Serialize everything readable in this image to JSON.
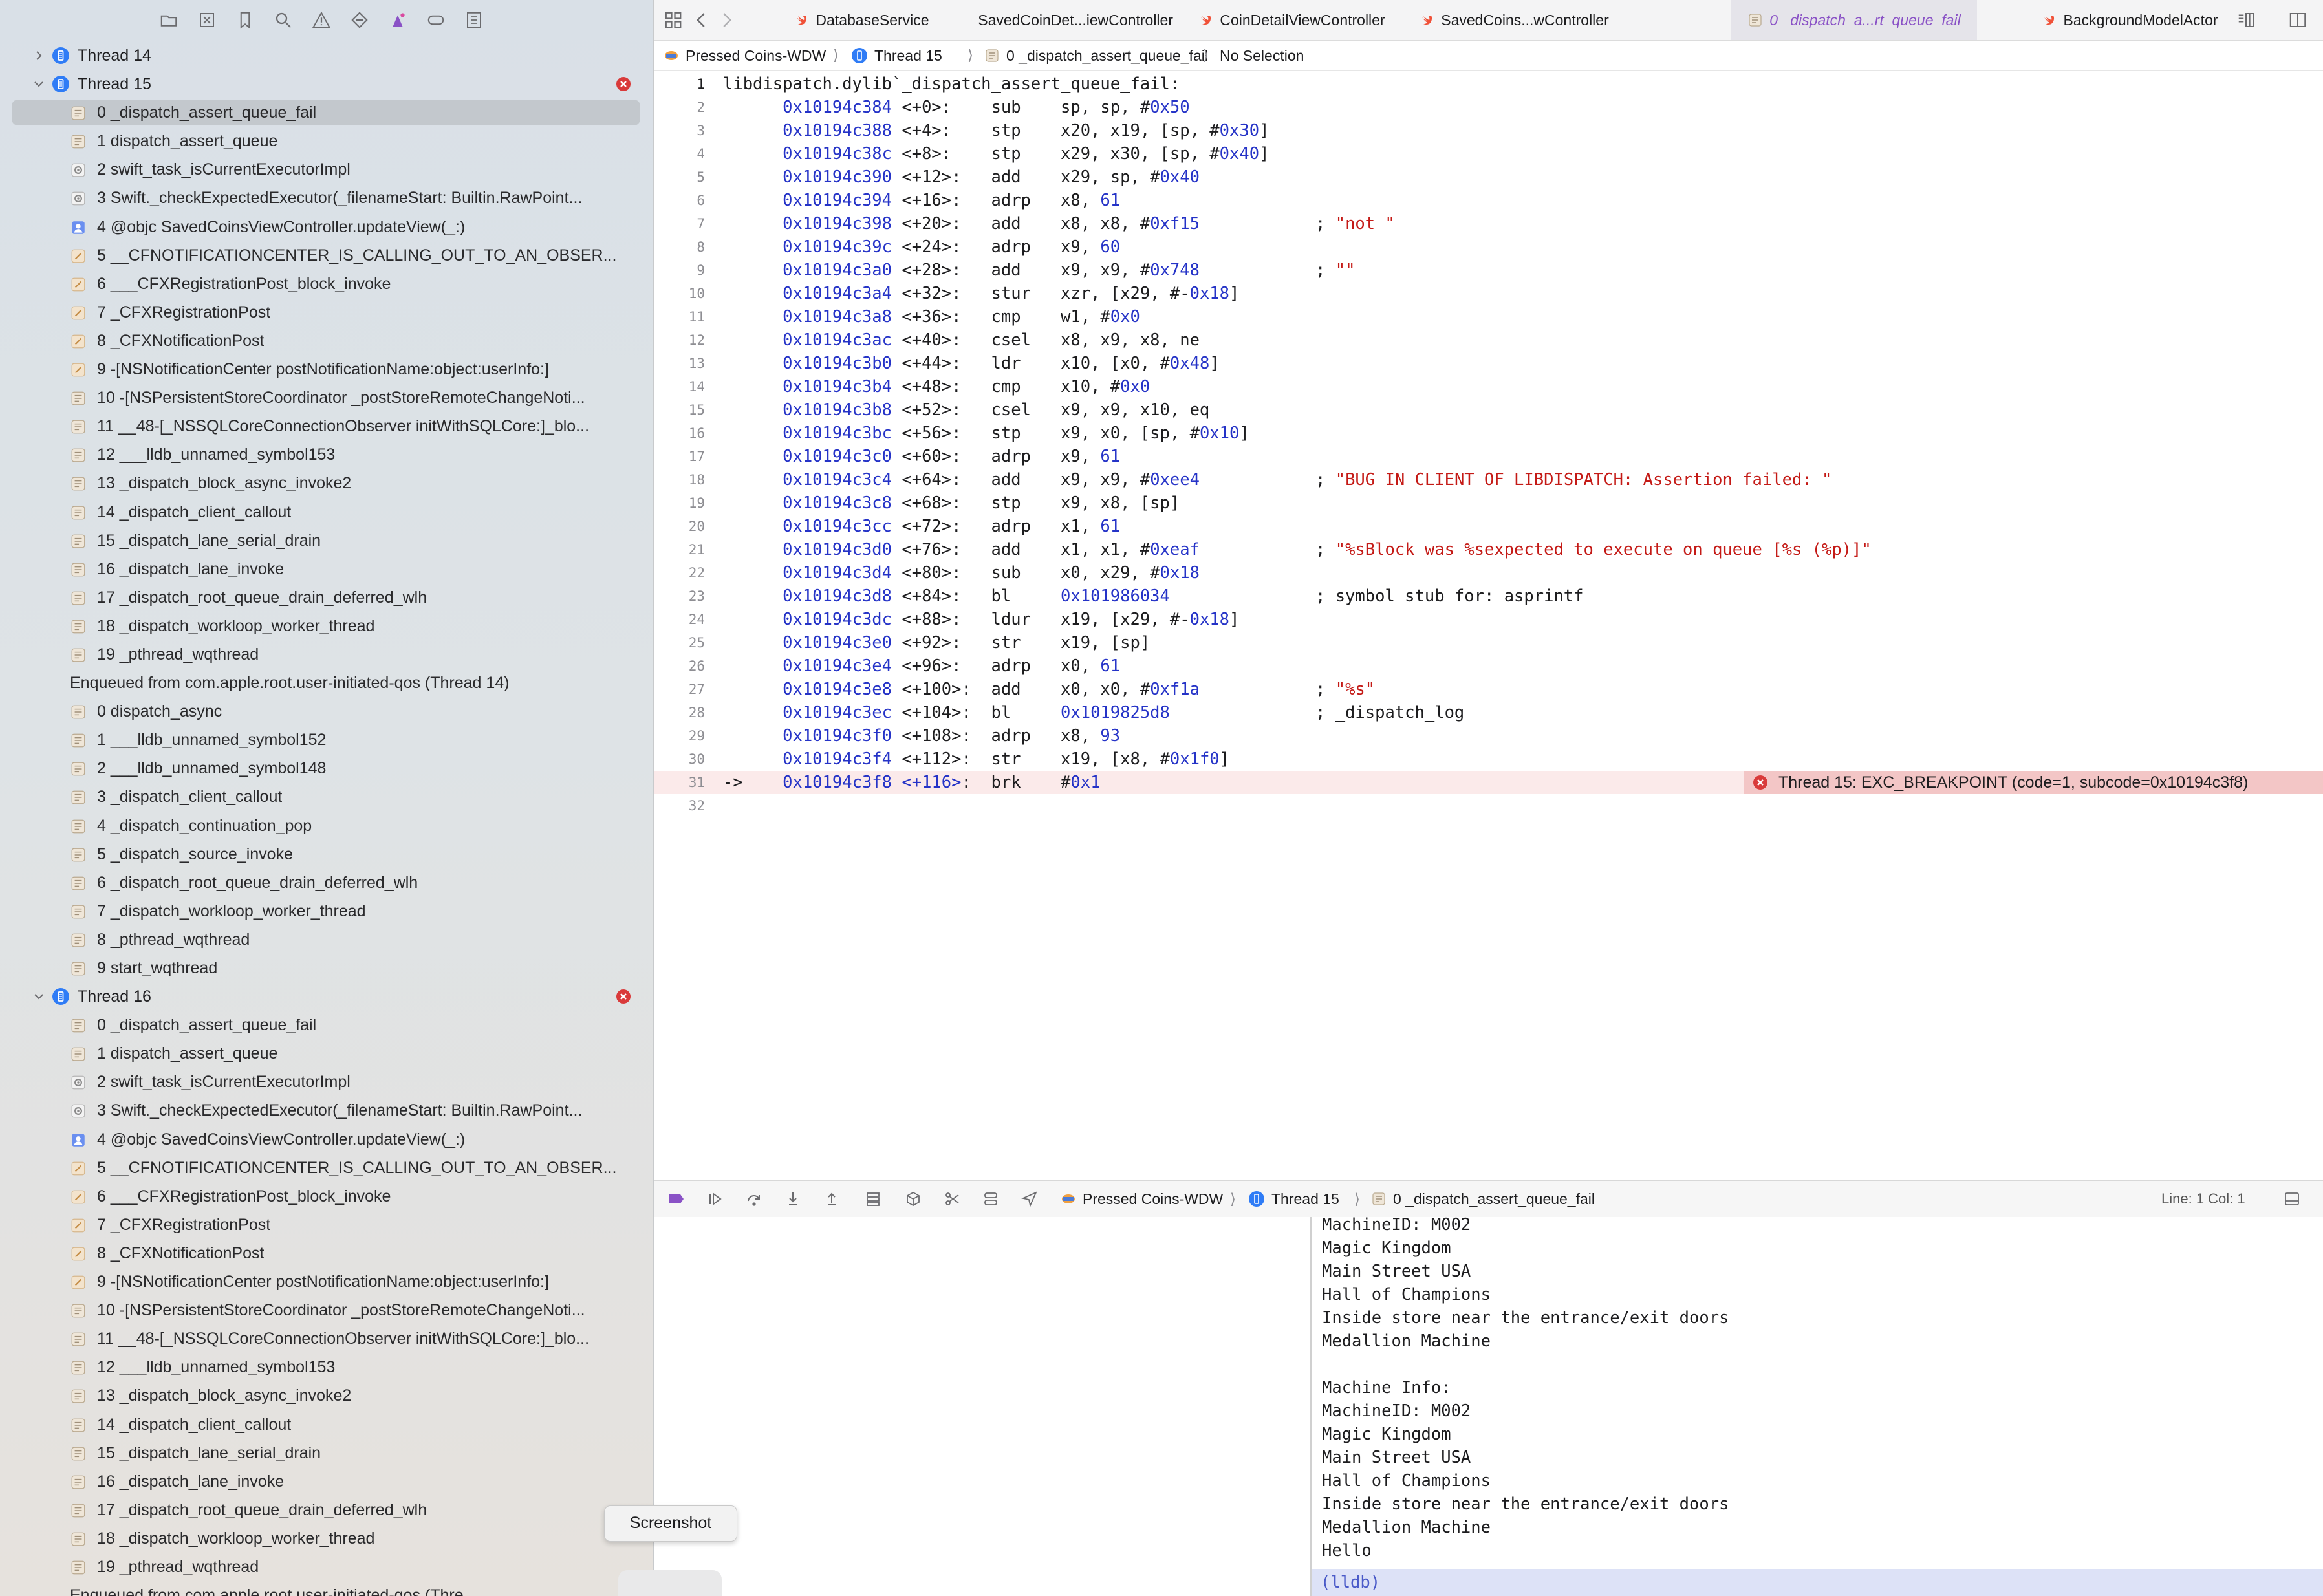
{
  "colors": {
    "accent_blue": "#2f7cf6",
    "error_red": "#d93a3a",
    "string_red": "#c41a16",
    "address_blue": "#2533c7",
    "pc_line_bg": "#fbeaea",
    "error_banner_bg": "#f3c6c6",
    "active_tab_purple": "#8a52c6",
    "lldb_bar_bg": "#dde2f7"
  },
  "navigator": {
    "toolbar_icons": [
      "folder-icon",
      "source-control-x-icon",
      "bookmark-icon",
      "search-icon",
      "warning-icon",
      "diamond-icon",
      "debug-spray-icon",
      "tag-icon",
      "report-icon"
    ],
    "rows": [
      {
        "type": "thread",
        "label": "Thread 14",
        "expanded": false,
        "error": false
      },
      {
        "type": "thread",
        "label": "Thread 15",
        "expanded": true,
        "error": true
      },
      {
        "type": "frame",
        "label": "0 _dispatch_assert_queue_fail",
        "icon": "library-icon",
        "selected": true
      },
      {
        "type": "frame",
        "label": "1 dispatch_assert_queue",
        "icon": "library-icon"
      },
      {
        "type": "frame",
        "label": "2 swift_task_isCurrentExecutorImpl",
        "icon": "gear-icon"
      },
      {
        "type": "frame",
        "label": "3 Swift._checkExpectedExecutor(_filenameStart: Builtin.RawPoint...",
        "icon": "gear-icon"
      },
      {
        "type": "frame",
        "label": "4 @objc SavedCoinsViewController.updateView(_:)",
        "icon": "user-icon"
      },
      {
        "type": "frame",
        "label": "5 __CFNOTIFICATIONCENTER_IS_CALLING_OUT_TO_AN_OBSER...",
        "icon": "tool-icon"
      },
      {
        "type": "frame",
        "label": "6 ___CFXRegistrationPost_block_invoke",
        "icon": "tool-icon"
      },
      {
        "type": "frame",
        "label": "7 _CFXRegistrationPost",
        "icon": "tool-icon"
      },
      {
        "type": "frame",
        "label": "8 _CFXNotificationPost",
        "icon": "tool-icon"
      },
      {
        "type": "frame",
        "label": "9 -[NSNotificationCenter postNotificationName:object:userInfo:]",
        "icon": "tool-icon"
      },
      {
        "type": "frame",
        "label": "10 -[NSPersistentStoreCoordinator _postStoreRemoteChangeNoti...",
        "icon": "library-icon"
      },
      {
        "type": "frame",
        "label": "11 __48-[_NSSQLCoreConnectionObserver initWithSQLCore:]_blo...",
        "icon": "library-icon"
      },
      {
        "type": "frame",
        "label": "12 ___lldb_unnamed_symbol153",
        "icon": "library-icon"
      },
      {
        "type": "frame",
        "label": "13 _dispatch_block_async_invoke2",
        "icon": "library-icon"
      },
      {
        "type": "frame",
        "label": "14 _dispatch_client_callout",
        "icon": "library-icon"
      },
      {
        "type": "frame",
        "label": "15 _dispatch_lane_serial_drain",
        "icon": "library-icon"
      },
      {
        "type": "frame",
        "label": "16 _dispatch_lane_invoke",
        "icon": "library-icon"
      },
      {
        "type": "frame",
        "label": "17 _dispatch_root_queue_drain_deferred_wlh",
        "icon": "library-icon"
      },
      {
        "type": "frame",
        "label": "18 _dispatch_workloop_worker_thread",
        "icon": "library-icon"
      },
      {
        "type": "frame",
        "label": "19 _pthread_wqthread",
        "icon": "library-icon"
      },
      {
        "type": "enq",
        "label": "Enqueued from com.apple.root.user-initiated-qos (Thread 14)"
      },
      {
        "type": "frame",
        "label": "0 dispatch_async",
        "icon": "library-icon"
      },
      {
        "type": "frame",
        "label": "1 ___lldb_unnamed_symbol152",
        "icon": "library-icon"
      },
      {
        "type": "frame",
        "label": "2 ___lldb_unnamed_symbol148",
        "icon": "library-icon"
      },
      {
        "type": "frame",
        "label": "3 _dispatch_client_callout",
        "icon": "library-icon"
      },
      {
        "type": "frame",
        "label": "4 _dispatch_continuation_pop",
        "icon": "library-icon"
      },
      {
        "type": "frame",
        "label": "5 _dispatch_source_invoke",
        "icon": "library-icon"
      },
      {
        "type": "frame",
        "label": "6 _dispatch_root_queue_drain_deferred_wlh",
        "icon": "library-icon"
      },
      {
        "type": "frame",
        "label": "7 _dispatch_workloop_worker_thread",
        "icon": "library-icon"
      },
      {
        "type": "frame",
        "label": "8 _pthread_wqthread",
        "icon": "library-icon"
      },
      {
        "type": "frame",
        "label": "9 start_wqthread",
        "icon": "library-icon"
      },
      {
        "type": "thread",
        "label": "Thread 16",
        "expanded": true,
        "error": true
      },
      {
        "type": "frame",
        "label": "0 _dispatch_assert_queue_fail",
        "icon": "library-icon"
      },
      {
        "type": "frame",
        "label": "1 dispatch_assert_queue",
        "icon": "library-icon"
      },
      {
        "type": "frame",
        "label": "2 swift_task_isCurrentExecutorImpl",
        "icon": "gear-icon"
      },
      {
        "type": "frame",
        "label": "3 Swift._checkExpectedExecutor(_filenameStart: Builtin.RawPoint...",
        "icon": "gear-icon"
      },
      {
        "type": "frame",
        "label": "4 @objc SavedCoinsViewController.updateView(_:)",
        "icon": "user-icon"
      },
      {
        "type": "frame",
        "label": "5 __CFNOTIFICATIONCENTER_IS_CALLING_OUT_TO_AN_OBSER...",
        "icon": "tool-icon"
      },
      {
        "type": "frame",
        "label": "6 ___CFXRegistrationPost_block_invoke",
        "icon": "tool-icon"
      },
      {
        "type": "frame",
        "label": "7 _CFXRegistrationPost",
        "icon": "tool-icon"
      },
      {
        "type": "frame",
        "label": "8 _CFXNotificationPost",
        "icon": "tool-icon"
      },
      {
        "type": "frame",
        "label": "9 -[NSNotificationCenter postNotificationName:object:userInfo:]",
        "icon": "tool-icon"
      },
      {
        "type": "frame",
        "label": "10 -[NSPersistentStoreCoordinator _postStoreRemoteChangeNoti...",
        "icon": "library-icon"
      },
      {
        "type": "frame",
        "label": "11 __48-[_NSSQLCoreConnectionObserver initWithSQLCore:]_blo...",
        "icon": "library-icon"
      },
      {
        "type": "frame",
        "label": "12 ___lldb_unnamed_symbol153",
        "icon": "library-icon"
      },
      {
        "type": "frame",
        "label": "13 _dispatch_block_async_invoke2",
        "icon": "library-icon"
      },
      {
        "type": "frame",
        "label": "14 _dispatch_client_callout",
        "icon": "library-icon"
      },
      {
        "type": "frame",
        "label": "15 _dispatch_lane_serial_drain",
        "icon": "library-icon"
      },
      {
        "type": "frame",
        "label": "16 _dispatch_lane_invoke",
        "icon": "library-icon"
      },
      {
        "type": "frame",
        "label": "17 _dispatch_root_queue_drain_deferred_wlh",
        "icon": "library-icon"
      },
      {
        "type": "frame",
        "label": "18 _dispatch_workloop_worker_thread",
        "icon": "library-icon"
      },
      {
        "type": "frame",
        "label": "19 _pthread_wqthread",
        "icon": "library-icon"
      },
      {
        "type": "enq",
        "label": "Enqueued from com.apple.root.user-initiated-qos (Thre"
      }
    ]
  },
  "tabs": [
    {
      "label": "DatabaseService",
      "icon": "swift-icon",
      "active": false
    },
    {
      "label": "SavedCoinDet...iewController",
      "icon": "swift-icon",
      "active": false
    },
    {
      "label": "CoinDetailViewController",
      "icon": "swift-icon",
      "active": false
    },
    {
      "label": "SavedCoins...wController",
      "icon": "swift-icon",
      "active": false
    },
    {
      "label": "0 _dispatch_a...rt_queue_fail",
      "icon": "library-icon",
      "active": true
    },
    {
      "label": "BackgroundModelActor",
      "icon": "swift-icon",
      "active": false
    }
  ],
  "jumpbar": {
    "project": "Pressed Coins-WDW",
    "thread": "Thread 15",
    "frame": "0 _dispatch_assert_queue_fail",
    "selection": "No Selection"
  },
  "code": {
    "current_line": 31,
    "lines": [
      {
        "n": 1,
        "addr": "",
        "off": "",
        "mn": "",
        "ops": "",
        "comment": "",
        "header": "libdispatch.dylib`_dispatch_assert_queue_fail:"
      },
      {
        "n": 2,
        "addr": "0x10194c384",
        "off": "<+0>:",
        "mn": "sub",
        "ops": "sp, sp, #0x50",
        "comment": ""
      },
      {
        "n": 3,
        "addr": "0x10194c388",
        "off": "<+4>:",
        "mn": "stp",
        "ops": "x20, x19, [sp, #0x30]",
        "comment": ""
      },
      {
        "n": 4,
        "addr": "0x10194c38c",
        "off": "<+8>:",
        "mn": "stp",
        "ops": "x29, x30, [sp, #0x40]",
        "comment": ""
      },
      {
        "n": 5,
        "addr": "0x10194c390",
        "off": "<+12>:",
        "mn": "add",
        "ops": "x29, sp, #0x40",
        "comment": ""
      },
      {
        "n": 6,
        "addr": "0x10194c394",
        "off": "<+16>:",
        "mn": "adrp",
        "ops": "x8, 61",
        "comment": ""
      },
      {
        "n": 7,
        "addr": "0x10194c398",
        "off": "<+20>:",
        "mn": "add",
        "ops": "x8, x8, #0xf15",
        "comment": "; \"not \""
      },
      {
        "n": 8,
        "addr": "0x10194c39c",
        "off": "<+24>:",
        "mn": "adrp",
        "ops": "x9, 60",
        "comment": ""
      },
      {
        "n": 9,
        "addr": "0x10194c3a0",
        "off": "<+28>:",
        "mn": "add",
        "ops": "x9, x9, #0x748",
        "comment": "; \"\""
      },
      {
        "n": 10,
        "addr": "0x10194c3a4",
        "off": "<+32>:",
        "mn": "stur",
        "ops": "xzr, [x29, #-0x18]",
        "comment": ""
      },
      {
        "n": 11,
        "addr": "0x10194c3a8",
        "off": "<+36>:",
        "mn": "cmp",
        "ops": "w1, #0x0",
        "comment": ""
      },
      {
        "n": 12,
        "addr": "0x10194c3ac",
        "off": "<+40>:",
        "mn": "csel",
        "ops": "x8, x9, x8, ne",
        "comment": ""
      },
      {
        "n": 13,
        "addr": "0x10194c3b0",
        "off": "<+44>:",
        "mn": "ldr",
        "ops": "x10, [x0, #0x48]",
        "comment": ""
      },
      {
        "n": 14,
        "addr": "0x10194c3b4",
        "off": "<+48>:",
        "mn": "cmp",
        "ops": "x10, #0x0",
        "comment": ""
      },
      {
        "n": 15,
        "addr": "0x10194c3b8",
        "off": "<+52>:",
        "mn": "csel",
        "ops": "x9, x9, x10, eq",
        "comment": ""
      },
      {
        "n": 16,
        "addr": "0x10194c3bc",
        "off": "<+56>:",
        "mn": "stp",
        "ops": "x9, x0, [sp, #0x10]",
        "comment": ""
      },
      {
        "n": 17,
        "addr": "0x10194c3c0",
        "off": "<+60>:",
        "mn": "adrp",
        "ops": "x9, 61",
        "comment": ""
      },
      {
        "n": 18,
        "addr": "0x10194c3c4",
        "off": "<+64>:",
        "mn": "add",
        "ops": "x9, x9, #0xee4",
        "comment": "; \"BUG IN CLIENT OF LIBDISPATCH: Assertion failed: \""
      },
      {
        "n": 19,
        "addr": "0x10194c3c8",
        "off": "<+68>:",
        "mn": "stp",
        "ops": "x9, x8, [sp]",
        "comment": ""
      },
      {
        "n": 20,
        "addr": "0x10194c3cc",
        "off": "<+72>:",
        "mn": "adrp",
        "ops": "x1, 61",
        "comment": ""
      },
      {
        "n": 21,
        "addr": "0x10194c3d0",
        "off": "<+76>:",
        "mn": "add",
        "ops": "x1, x1, #0xeaf",
        "comment": "; \"%sBlock was %sexpected to execute on queue [%s (%p)]\""
      },
      {
        "n": 22,
        "addr": "0x10194c3d4",
        "off": "<+80>:",
        "mn": "sub",
        "ops": "x0, x29, #0x18",
        "comment": ""
      },
      {
        "n": 23,
        "addr": "0x10194c3d8",
        "off": "<+84>:",
        "mn": "bl",
        "ops": "0x101986034",
        "comment": "; symbol stub for: asprintf"
      },
      {
        "n": 24,
        "addr": "0x10194c3dc",
        "off": "<+88>:",
        "mn": "ldur",
        "ops": "x19, [x29, #-0x18]",
        "comment": ""
      },
      {
        "n": 25,
        "addr": "0x10194c3e0",
        "off": "<+92>:",
        "mn": "str",
        "ops": "x19, [sp]",
        "comment": ""
      },
      {
        "n": 26,
        "addr": "0x10194c3e4",
        "off": "<+96>:",
        "mn": "adrp",
        "ops": "x0, 61",
        "comment": ""
      },
      {
        "n": 27,
        "addr": "0x10194c3e8",
        "off": "<+100>:",
        "mn": "add",
        "ops": "x0, x0, #0xf1a",
        "comment": "; \"%s\""
      },
      {
        "n": 28,
        "addr": "0x10194c3ec",
        "off": "<+104>:",
        "mn": "bl",
        "ops": "0x1019825d8",
        "comment": "; _dispatch_log"
      },
      {
        "n": 29,
        "addr": "0x10194c3f0",
        "off": "<+108>:",
        "mn": "adrp",
        "ops": "x8, 93",
        "comment": ""
      },
      {
        "n": 30,
        "addr": "0x10194c3f4",
        "off": "<+112>:",
        "mn": "str",
        "ops": "x19, [x8, #0x1f0]",
        "comment": ""
      },
      {
        "n": 31,
        "addr": "0x10194c3f8",
        "off": "<+116>:",
        "mn": "brk",
        "ops": "#0x1",
        "comment": "",
        "pc_marker": "->"
      },
      {
        "n": 32,
        "addr": "",
        "off": "",
        "mn": "",
        "ops": "",
        "comment": ""
      }
    ],
    "error_banner": "Thread 15: EXC_BREAKPOINT (code=1, subcode=0x10194c3f8)"
  },
  "debugbar": {
    "icons": [
      "breakpoints-toggle-icon",
      "continue-icon",
      "step-over-icon",
      "step-into-icon",
      "step-out-icon",
      "debug-view-hierarchy-icon",
      "memory-graph-icon",
      "environment-overrides-icon",
      "simulate-location-icon",
      "location-arrow-icon"
    ],
    "project": "Pressed Coins-WDW",
    "thread": "Thread 15",
    "frame": "0 _dispatch_assert_queue_fail",
    "line_col": "Line: 1  Col: 1"
  },
  "console": {
    "lines": [
      "MachineID: M002",
      "Magic Kingdom",
      "Main Street USA",
      "Hall of Champions",
      "Inside store near the entrance/exit doors",
      "Medallion Machine",
      "",
      "Machine Info:",
      "MachineID: M002",
      "Magic Kingdom",
      "Main Street USA",
      "Hall of Champions",
      "Inside store near the entrance/exit doors",
      "Medallion Machine",
      "Hello"
    ],
    "prompt": "(lldb)"
  },
  "tooltip": {
    "label": "Screenshot"
  }
}
